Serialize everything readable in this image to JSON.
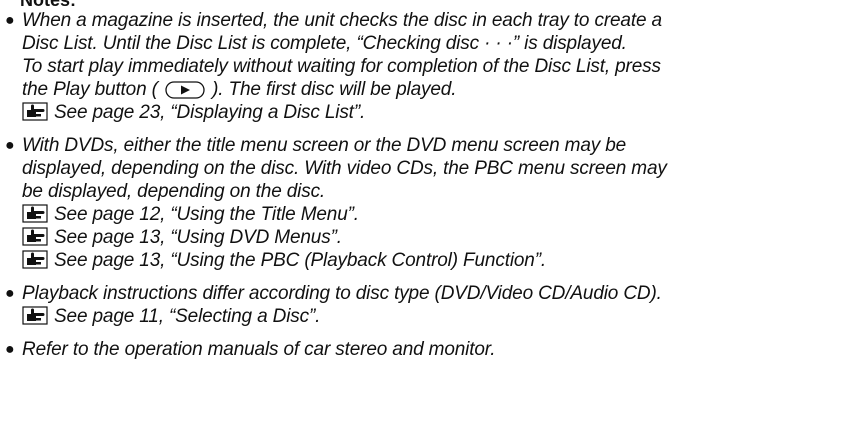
{
  "notes_title": "Notes:",
  "notes": [
    {
      "lines": [
        "When a magazine is inserted, the unit checks the disc in each tray to create a",
        "Disc List. Until the Disc List is complete, “Checking disc · · ·” is displayed.",
        "To start play immediately without waiting for completion of the Disc List, press"
      ],
      "play_line_before": "the Play button (",
      "play_icon": "play-button-icon",
      "play_line_after": "). The first disc will be played.",
      "refs": [
        "See page 23, “Displaying a Disc List”."
      ]
    },
    {
      "lines": [
        "With DVDs, either the title menu screen or the DVD menu screen may be",
        "displayed, depending on the disc. With video CDs, the PBC menu screen may",
        "be displayed, depending on the disc."
      ],
      "refs": [
        "See page 12, “Using the Title Menu”.",
        "See page 13, “Using DVD Menus”.",
        "See page 13, “Using the PBC (Playback Control) Function”."
      ]
    },
    {
      "lines": [
        "Playback instructions differ according to disc type (DVD/Video CD/Audio CD)."
      ],
      "refs": [
        "See page 11, “Selecting a Disc”."
      ]
    },
    {
      "lines": [
        "Refer to the operation manuals of car stereo and monitor."
      ],
      "refs": []
    }
  ],
  "bullet_symbol": "●",
  "ref_icon": "reference-hand-icon"
}
